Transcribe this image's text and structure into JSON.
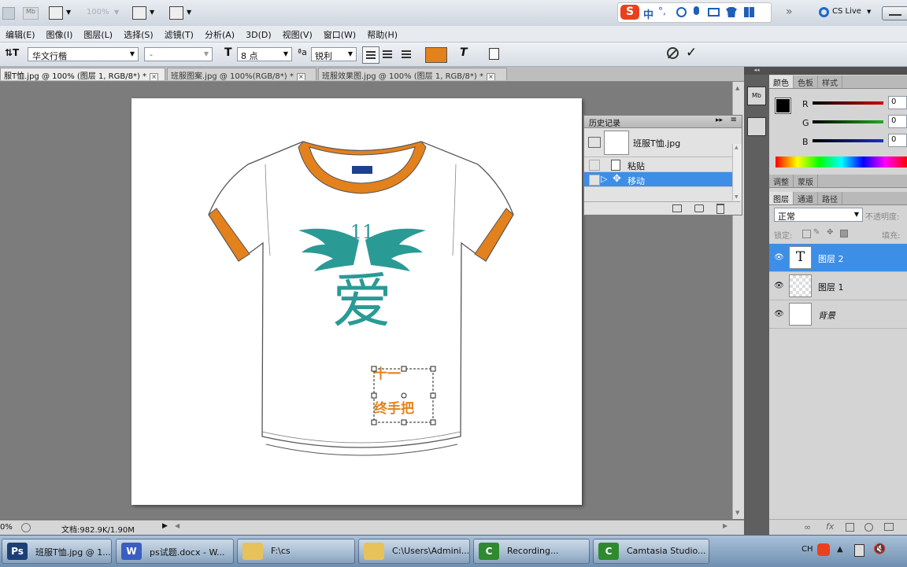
{
  "app": {
    "ps_logo": "Ps",
    "mb_label": "Mb",
    "zoom_value": "100%",
    "cs_live": "CS Live"
  },
  "menu": {
    "items": [
      "编辑(E)",
      "图像(I)",
      "图层(L)",
      "选择(S)",
      "滤镜(T)",
      "分析(A)",
      "3D(D)",
      "视图(V)",
      "窗口(W)",
      "帮助(H)"
    ]
  },
  "ime": {
    "logo": "S",
    "mode": "中",
    "punct": "°,"
  },
  "options": {
    "font_family": "华文行楷",
    "font_style": "-",
    "font_size": "8 点",
    "antialias": "锐利",
    "text_color": "#e3811d"
  },
  "tabs": [
    {
      "label": "服T恤.jpg @ 100% (图层 1, RGB/8*) *",
      "active": true
    },
    {
      "label": "班服图案.jpg @ 100%(RGB/8*) *",
      "active": false
    },
    {
      "label": "班服效果图.jpg @ 100% (图层 1, RGB/8*) *",
      "active": false
    }
  ],
  "canvas": {
    "shirt_color": "#ffffff",
    "trim_color": "#e3811d",
    "emblem_color": "#2a9a95",
    "emblem_text": "11",
    "emblem_char": "爱",
    "pocket_text_line1": "十一",
    "pocket_text_line2": "终手把"
  },
  "history": {
    "title": "历史记录",
    "snapshot": "班服T恤.jpg",
    "steps": [
      {
        "label": "粘贴",
        "selected": false
      },
      {
        "label": "移动",
        "selected": true
      }
    ]
  },
  "color_panel": {
    "tabs": [
      "颜色",
      "色板",
      "样式"
    ],
    "channels": [
      {
        "name": "R",
        "value": "0",
        "color": "#cc0000"
      },
      {
        "name": "G",
        "value": "0",
        "color": "#22aa22"
      },
      {
        "name": "B",
        "value": "0",
        "color": "#1a2fc7"
      }
    ]
  },
  "adjust_tabs": [
    "调整",
    "蒙版"
  ],
  "layers_panel": {
    "tabs": [
      "图层",
      "通道",
      "路径"
    ],
    "blend_mode": "正常",
    "opacity_label": "不透明度:",
    "lock_label": "锁定:",
    "fill_label": "填充:",
    "layers": [
      {
        "name": "图层 2",
        "type": "text",
        "thumb": "T",
        "selected": true
      },
      {
        "name": "图层 1",
        "type": "pixel",
        "thumb": "",
        "selected": false
      },
      {
        "name": "背景",
        "type": "background",
        "thumb": "",
        "selected": false
      }
    ]
  },
  "status": {
    "zoom": "0%",
    "doc_info": "文档:982.9K/1.90M"
  },
  "taskbar": {
    "items": [
      {
        "label": "班服T恤.jpg @ 1...",
        "icon_color": "#1b3f78",
        "icon_text": "Ps"
      },
      {
        "label": "ps试题.docx - W...",
        "icon_color": "#3b5fc0",
        "icon_text": "W"
      },
      {
        "label": "F:\\cs",
        "icon_color": "#e7c25a",
        "icon_text": ""
      },
      {
        "label": "C:\\Users\\Admini...",
        "icon_color": "#e7c25a",
        "icon_text": ""
      },
      {
        "label": "Recording...",
        "icon_color": "#2f8a2f",
        "icon_text": "C"
      },
      {
        "label": "Camtasia Studio...",
        "icon_color": "#2f8a2f",
        "icon_text": "C"
      }
    ],
    "tray_lang": "CH"
  }
}
